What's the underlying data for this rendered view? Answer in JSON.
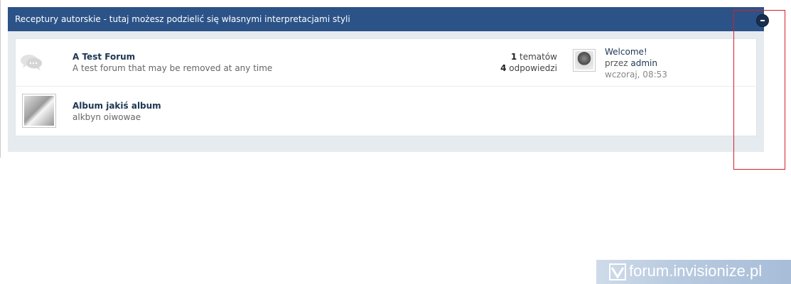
{
  "category": {
    "title": "Receptury autorskie - tutaj możesz podzielić się własnymi interpretacjami styli"
  },
  "forums": [
    {
      "name": "A Test Forum",
      "description": "A test forum that may be removed at any time",
      "topics_count": "1",
      "topics_label": "tematów",
      "replies_count": "4",
      "replies_label": "odpowiedzi",
      "last_post": {
        "title": "Welcome!",
        "by_label": "przez",
        "author": "admin",
        "date": "wczoraj, 08:53"
      },
      "icon": "speech-bubbles-icon"
    },
    {
      "name": "Album jakiś album",
      "description": "alkbyn oiwowae",
      "icon": "album-thumbnail"
    }
  ],
  "watermark": {
    "text": "forum.invisionize.pl"
  },
  "colors": {
    "header": "#2c5388",
    "highlight": "#d4202c"
  }
}
